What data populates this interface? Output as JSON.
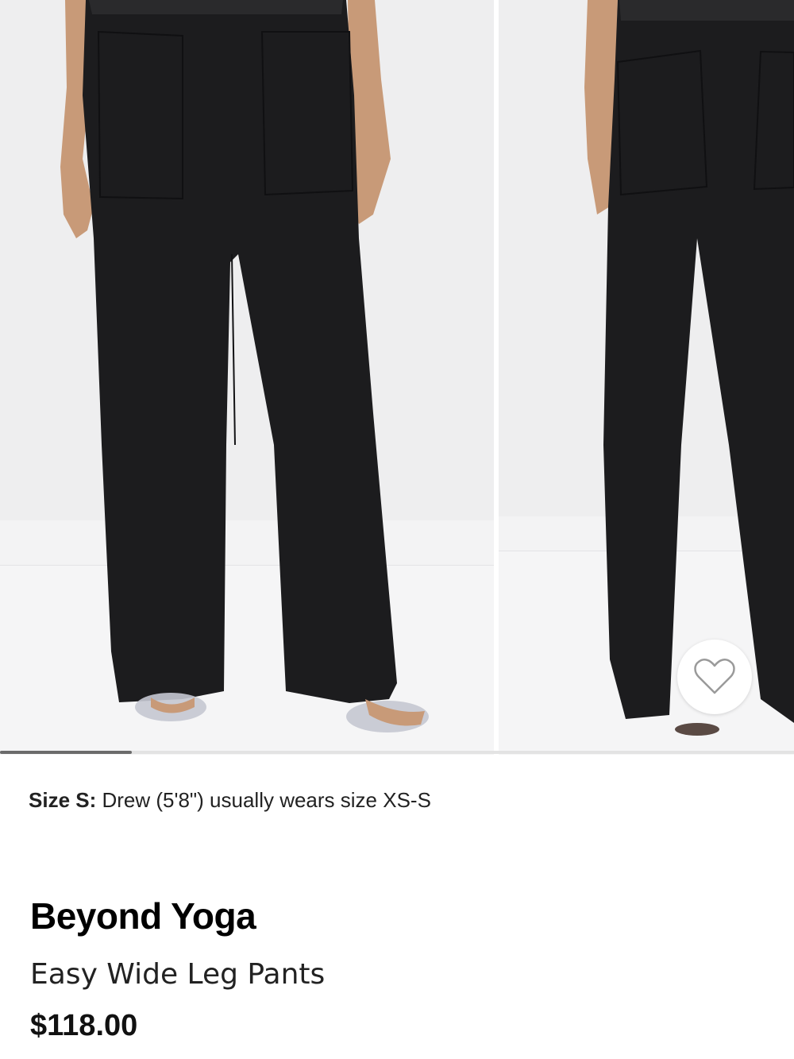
{
  "gallery": {
    "images": [
      {
        "name": "front view"
      },
      {
        "name": "back view"
      }
    ],
    "progress_fraction": 0.166
  },
  "wishlist": {
    "icon": "heart-outline-icon"
  },
  "size_note": {
    "label": "Size S:",
    "text": "Drew (5'8\") usually wears size XS-S"
  },
  "product": {
    "brand": "Beyond Yoga",
    "name": "Easy Wide Leg Pants",
    "price": "$118.00"
  },
  "colors": {
    "pants": "#1c1c1e",
    "background": "#efeff0",
    "skin": "#c89a78"
  }
}
